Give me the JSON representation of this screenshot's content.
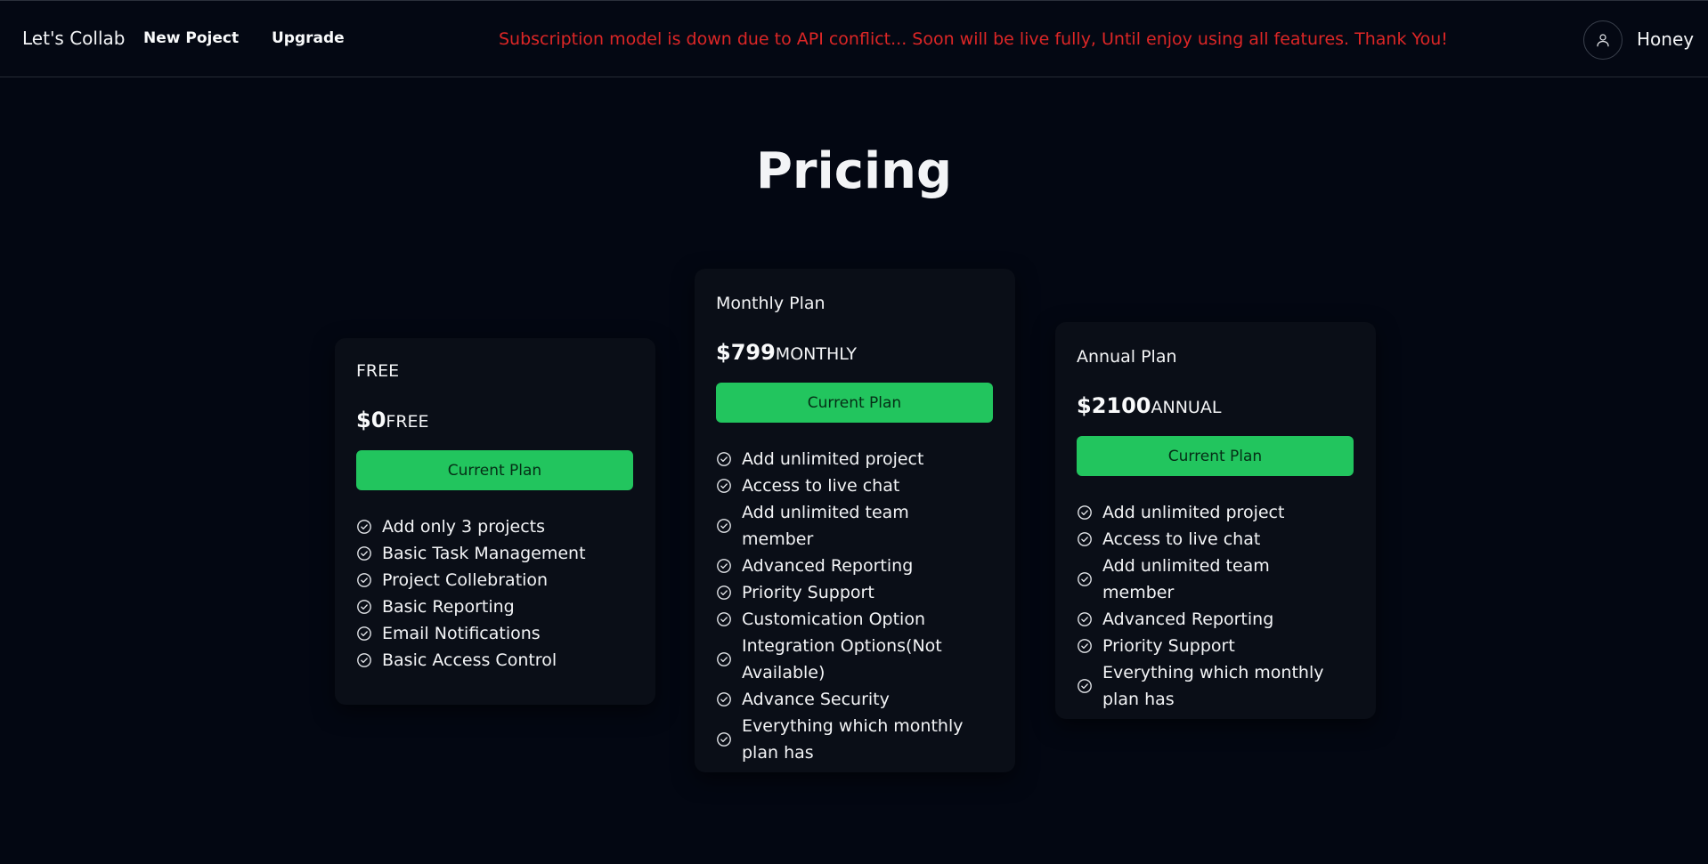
{
  "navbar": {
    "brand": "Let's Collab",
    "new_project": "New Poject",
    "upgrade": "Upgrade",
    "banner": "Subscription model is down due to API conflict... Soon will be live fully, Until enjoy using all features. Thank You!",
    "username": "Honey",
    "avatar_icon": "user-icon"
  },
  "colors": {
    "background": "#030712",
    "card": "#0a0e17",
    "accent": "#22c55e",
    "banner_text": "#dc2626"
  },
  "page": {
    "title": "Pricing"
  },
  "plans": [
    {
      "name": "FREE",
      "price": "$0",
      "period": "FREE",
      "button": "Current Plan",
      "features": [
        "Add only 3 projects",
        "Basic Task Management",
        "Project Collebration",
        "Basic Reporting",
        "Email Notifications",
        "Basic Access Control"
      ]
    },
    {
      "name": "Monthly Plan",
      "price": "$799",
      "period": "MONTHLY",
      "button": "Current Plan",
      "features": [
        "Add unlimited project",
        "Access to live chat",
        "Add unlimited team member",
        "Advanced Reporting",
        "Priority Support",
        "Customication Option",
        "Integration Options(Not Available)",
        "Advance Security",
        "Everything which monthly plan has"
      ]
    },
    {
      "name": "Annual Plan",
      "price": "$2100",
      "period": "ANNUAL",
      "button": "Current Plan",
      "features": [
        "Add unlimited project",
        "Access to live chat",
        "Add unlimited team member",
        "Advanced Reporting",
        "Priority Support",
        "Everything which monthly plan has"
      ]
    }
  ],
  "feature_icon": "check-circle-icon"
}
